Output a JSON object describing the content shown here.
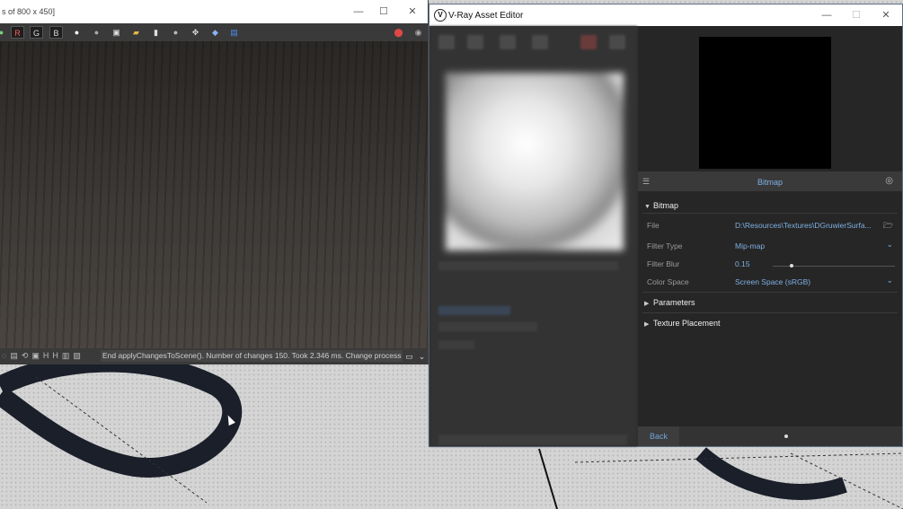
{
  "frame_buffer": {
    "title": "s of 800 x 450]",
    "window_buttons": {
      "minimize": "—",
      "maximize": "☐",
      "close": "✕"
    },
    "toolbar": {
      "channels": [
        "R",
        "G",
        "B"
      ]
    },
    "status_message": "End applyChangesToScene(). Number of changes 150. Took 2.346 ms. Change process"
  },
  "asset_editor": {
    "title": "V-Ray Asset Editor",
    "logo_letter": "V",
    "window_buttons": {
      "minimize": "—",
      "maximize": "☐",
      "close": "✕"
    },
    "asset_name": "Bitmap",
    "sections": {
      "bitmap": "Bitmap",
      "parameters": "Parameters",
      "texture_placement": "Texture Placement"
    },
    "properties": [
      {
        "label": "File",
        "value": "D:\\Resources\\Textures\\DGruwierSurfa..."
      },
      {
        "label": "Filter Type",
        "value": "Mip-map"
      },
      {
        "label": "Filter Blur",
        "value": "0.15"
      },
      {
        "label": "Color Space",
        "value": "Screen Space (sRGB)"
      }
    ],
    "filter_blur_level": 0.15,
    "back_label": "Back"
  },
  "colors": {
    "accent": "#7fb0e3",
    "panel": "#262626",
    "title_bar": "#ffffff"
  }
}
